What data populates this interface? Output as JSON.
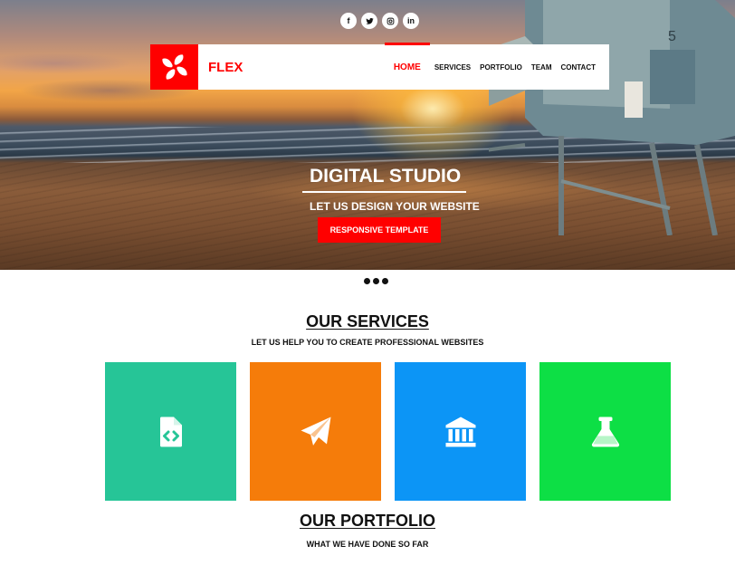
{
  "social": [
    {
      "icon": "facebook-icon",
      "glyph": "f"
    },
    {
      "icon": "twitter-icon",
      "glyph": "t"
    },
    {
      "icon": "instagram-icon",
      "glyph": "◎"
    },
    {
      "icon": "linkedin-icon",
      "glyph": "in"
    }
  ],
  "nav": {
    "brand": "FLEX",
    "items": [
      "HOME",
      "SERVICES",
      "PORTFOLIO",
      "TEAM",
      "CONTACT"
    ],
    "active": "HOME"
  },
  "hero": {
    "title": "DIGITAL STUDIO",
    "subtitle": "LET US DESIGN YOUR WEBSITE",
    "button": "RESPONSIVE TEMPLATE"
  },
  "services": {
    "title": "OUR SERVICES",
    "subtitle": "LET US HELP YOU TO CREATE PROFESSIONAL WEBSITES",
    "cards": [
      {
        "icon": "code-file-icon",
        "color": "#26c597"
      },
      {
        "icon": "paper-plane-icon",
        "color": "#f57c0a"
      },
      {
        "icon": "bank-icon",
        "color": "#0c95f6"
      },
      {
        "icon": "flask-icon",
        "color": "#0ddf45"
      }
    ]
  },
  "portfolio": {
    "title": "OUR PORTFOLIO",
    "subtitle": "WHAT WE HAVE DONE SO FAR"
  },
  "colors": {
    "accent": "#ff0000"
  }
}
